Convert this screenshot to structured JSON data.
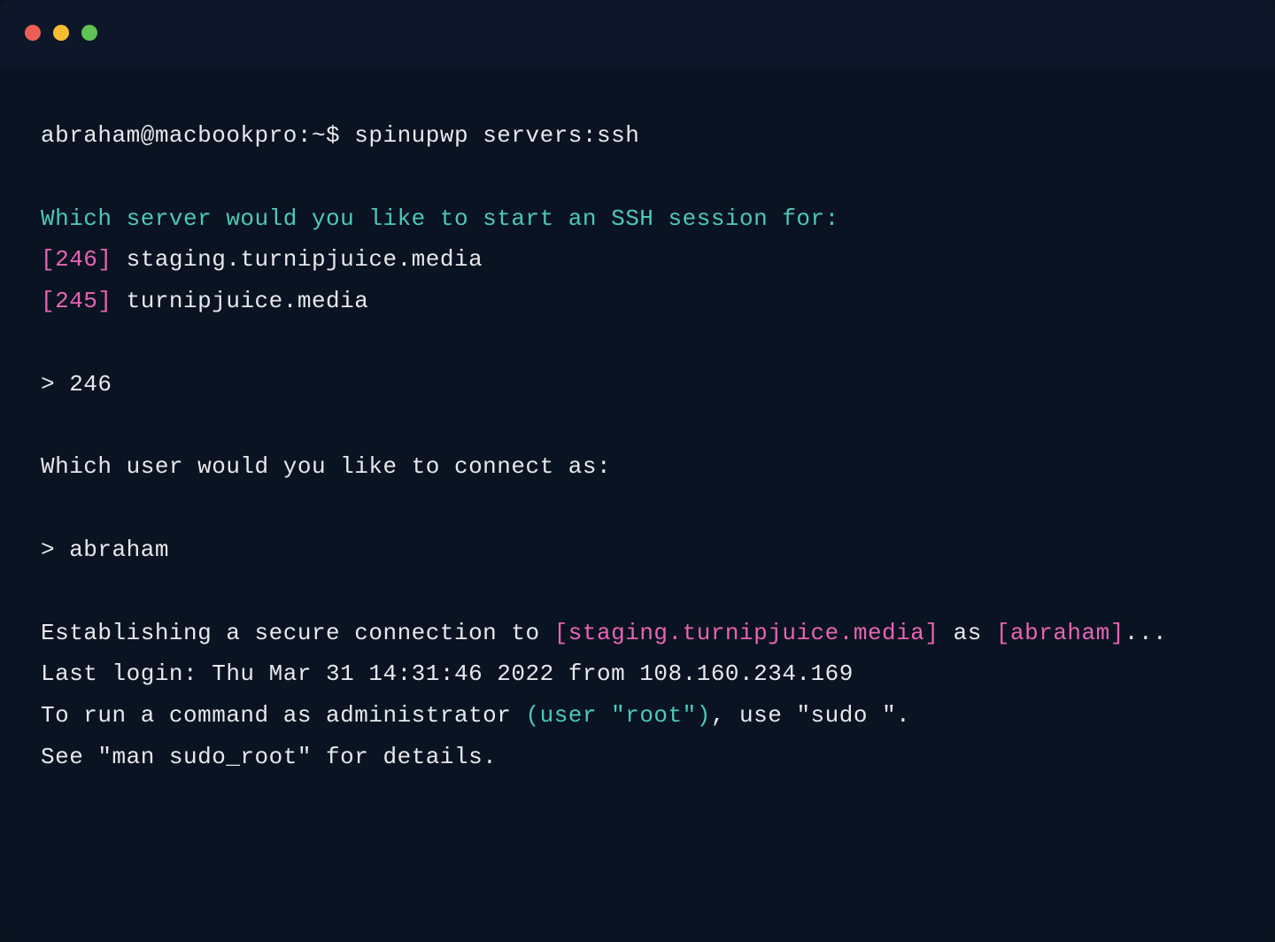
{
  "colors": {
    "bg": "#0a1321",
    "titlebar": "#0d1729",
    "text": "#e6e8ec",
    "teal": "#4cc9b7",
    "magenta": "#e764b4",
    "close": "#ec5f57",
    "minimize": "#f5bd2f",
    "zoom": "#5fc454"
  },
  "prompt": {
    "user_host": "abraham@macbookpro:~$ ",
    "command": "spinupwp servers:ssh"
  },
  "server_question": "Which server would you like to start an SSH session for:",
  "servers": [
    {
      "id": "[246]",
      "name": " staging.turnipjuice.media"
    },
    {
      "id": "[245]",
      "name": " turnipjuice.media"
    }
  ],
  "server_answer": "> 246",
  "user_question": "Which user would you like to connect as:",
  "user_answer": "> abraham",
  "connect": {
    "prefix": "Establishing a secure connection to ",
    "host": "[staging.turnipjuice.media]",
    "mid": " as ",
    "user": "[abraham]",
    "suffix": "..."
  },
  "last_login": "Last login: Thu Mar 31 14:31:46 2022 from 108.160.234.169",
  "admin": {
    "prefix": "To run a command as administrator ",
    "paren": "(user \"root\")",
    "suffix": ", use \"sudo \"."
  },
  "see_details": "See \"man sudo_root\" for details."
}
